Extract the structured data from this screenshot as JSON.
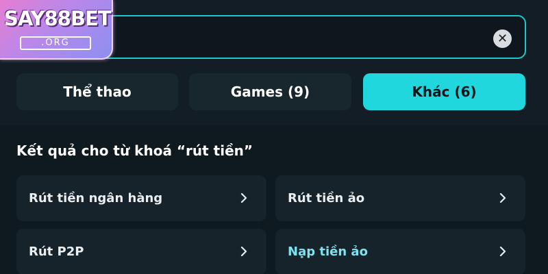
{
  "brand": {
    "name": "SAY88BET",
    "domain": ".ORG"
  },
  "search": {
    "value": "",
    "clear_icon": "close-icon"
  },
  "tabs": [
    {
      "label": "Thể thao",
      "active": false
    },
    {
      "label": "Games (9)",
      "active": false
    },
    {
      "label": "Khác (6)",
      "active": true
    }
  ],
  "results": {
    "title": "Kết quả cho từ khoá “rút tiền”",
    "items": [
      {
        "label": "Rút tiền ngân hàng",
        "icon": "chevron-right-icon"
      },
      {
        "label": "Rút tiền ảo",
        "icon": "chevron-right-icon"
      },
      {
        "label": "Rút P2P",
        "icon": "chevron-right-icon"
      },
      {
        "label": "Nạp tiền ảo",
        "icon": "chevron-right-icon"
      }
    ]
  },
  "colors": {
    "accent": "#1fd7dd",
    "background": "#0f1b22",
    "card": "#16232b",
    "highlight_text": "#7ee3ee"
  }
}
